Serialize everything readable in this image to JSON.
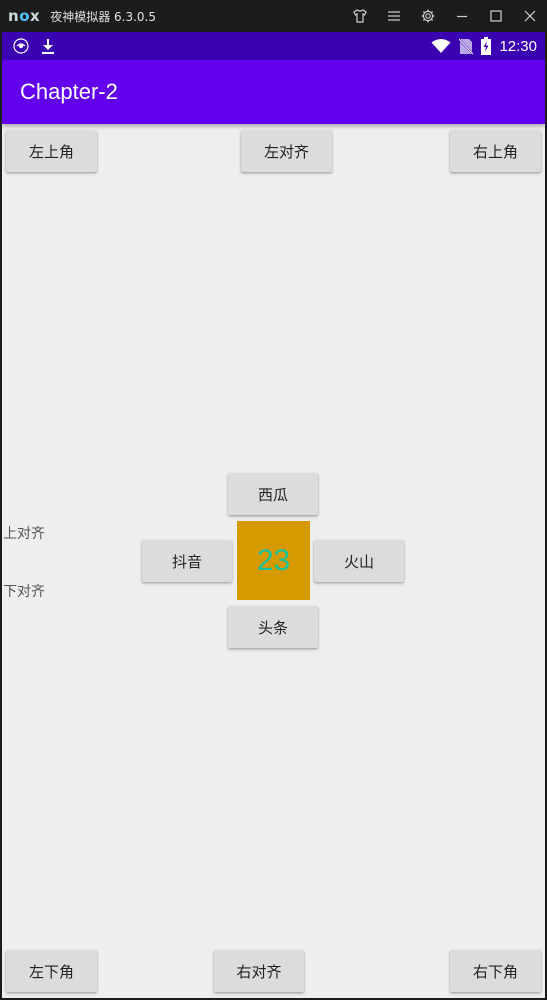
{
  "emulator": {
    "title": "夜神模拟器 6.3.0.5",
    "logo_prefix": "n",
    "logo_o": "o",
    "logo_suffix": "x",
    "controls": [
      "shirt-icon",
      "menu-icon",
      "gear-icon",
      "minimize-icon",
      "maximize-icon",
      "close-icon"
    ]
  },
  "statusbar": {
    "time": "12:30",
    "icons": [
      "nox-sync-icon",
      "download-icon",
      "wifi-icon",
      "no-sim-icon",
      "battery-charging-icon"
    ]
  },
  "appbar": {
    "title": "Chapter-2"
  },
  "buttons": {
    "top_left": "左上角",
    "top_center": "左对齐",
    "top_right": "右上角",
    "center_top": "西瓜",
    "center_left": "抖音",
    "center_right": "火山",
    "center_bottom": "头条",
    "bottom_left": "左下角",
    "bottom_center": "右对齐",
    "bottom_right": "右下角"
  },
  "labels": {
    "align_top": "上对齐",
    "align_bottom": "下对齐"
  },
  "center": {
    "value": "23"
  },
  "colors": {
    "appbar": "#6200ee",
    "statusbar": "#3b00b2",
    "center_box": "#d49a00",
    "center_text": "#19c39a",
    "background": "#eeeeee"
  }
}
